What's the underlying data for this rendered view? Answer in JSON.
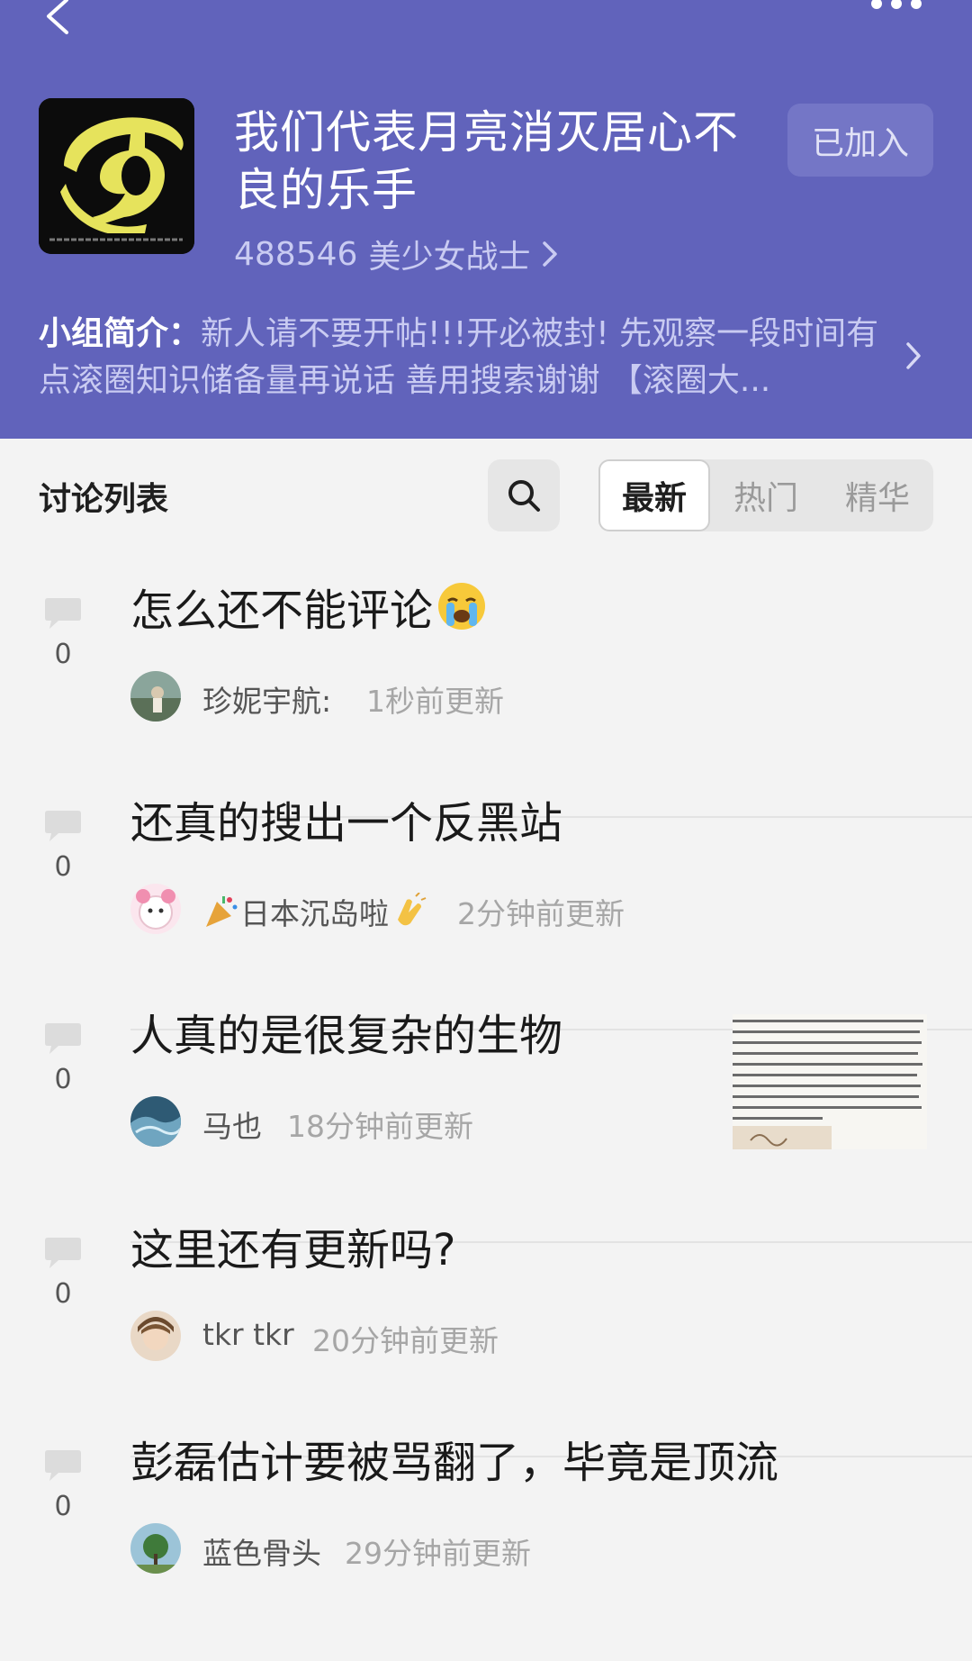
{
  "header": {
    "background_color": "#6163bb",
    "group_title": "我们代表月亮消灭居心不良的乐手",
    "member_count": "488546",
    "member_label": "美少女战士",
    "join_button": "已加入",
    "intro_label": "小组简介：",
    "intro_text": "新人请不要开帖!!!开必被封! 先观察一段时间有点滚圈知识储备量再说话 善用搜索谢谢 【滚圈大..."
  },
  "toolbar": {
    "title": "讨论列表",
    "tabs": [
      {
        "label": "最新",
        "active": true
      },
      {
        "label": "热门",
        "active": false
      },
      {
        "label": "精华",
        "active": false
      }
    ]
  },
  "posts": [
    {
      "title": "怎么还不能评论",
      "count": "0",
      "author": "珍妮宇航:",
      "time": "1秒前更新"
    },
    {
      "title": "还真的搜出一个反黑站",
      "count": "0",
      "author": "日本沉岛啦",
      "time": "2分钟前更新"
    },
    {
      "title": "人真的是很复杂的生物",
      "count": "0",
      "author": "马也",
      "time": "18分钟前更新"
    },
    {
      "title": "这里还有更新吗?",
      "count": "0",
      "author": "tkr tkr",
      "time": "20分钟前更新"
    },
    {
      "title": "彭磊估计要被骂翻了，毕竟是顶流",
      "count": "0",
      "author": "蓝色骨头",
      "time": "29分钟前更新"
    }
  ]
}
